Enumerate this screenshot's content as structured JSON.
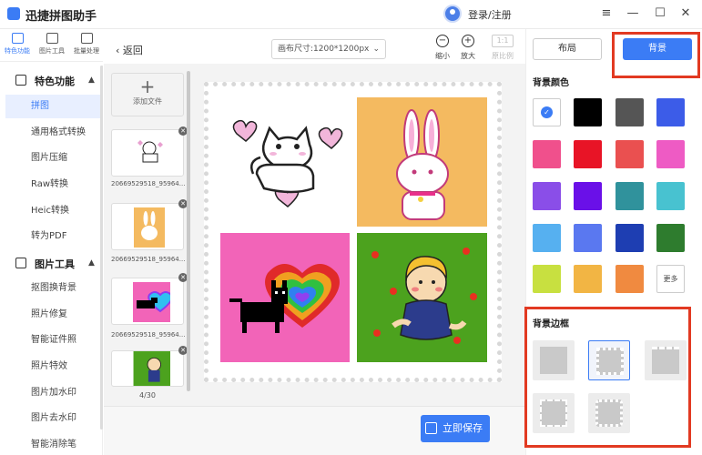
{
  "app": {
    "title": "迅捷拼图助手",
    "login": "登录/注册"
  },
  "window_controls": {
    "menu": "≡",
    "minimize": "—",
    "maximize": "☐",
    "close": "✕"
  },
  "top_icons": [
    {
      "label": "特色功能",
      "icon": "feature-grid-icon"
    },
    {
      "label": "图片工具",
      "icon": "image-tool-icon"
    },
    {
      "label": "批量处理",
      "icon": "batch-icon"
    }
  ],
  "sidebar": {
    "section1": "特色功能",
    "section1_items": [
      "拼图",
      "通用格式转换",
      "图片压缩",
      "Raw转换",
      "Heic转换",
      "转为PDF"
    ],
    "section2": "图片工具",
    "section2_items": [
      "抠图换背景",
      "照片修复",
      "智能证件照",
      "照片特效",
      "图片加水印",
      "图片去水印",
      "智能消除笔"
    ]
  },
  "toolbar": {
    "back": "返回",
    "canvas_size": "画布尺寸:1200*1200px",
    "zoom_out": "缩小",
    "zoom_in": "放大",
    "original_ratio": "原比例",
    "original_badge": "1:1"
  },
  "files": {
    "add": "添加文件",
    "names": [
      "20669529518_95964...",
      "20669529518_95964...",
      "20669529518_95964..."
    ],
    "page_indicator": "4/30"
  },
  "save_button": "立即保存",
  "panel": {
    "tab_layout": "布局",
    "tab_background": "背景",
    "bg_color_title": "背景颜色",
    "more": "更多",
    "bg_border_title": "背景边框",
    "colors": [
      "#ffffff",
      "#000000",
      "#555555",
      "#3c5ce8",
      "#f0508c",
      "#e81426",
      "#ea5050",
      "#ee5bc4",
      "#8a4ee8",
      "#6a10e8",
      "#30929c",
      "#48c2d0",
      "#56b0f0",
      "#5a78f0",
      "#1e3eb2",
      "#2e7c2e",
      "#c8e040",
      "#f2b544",
      "#f08a40"
    ],
    "accent": "#3b7cf5",
    "highlight": "#e23a22"
  }
}
